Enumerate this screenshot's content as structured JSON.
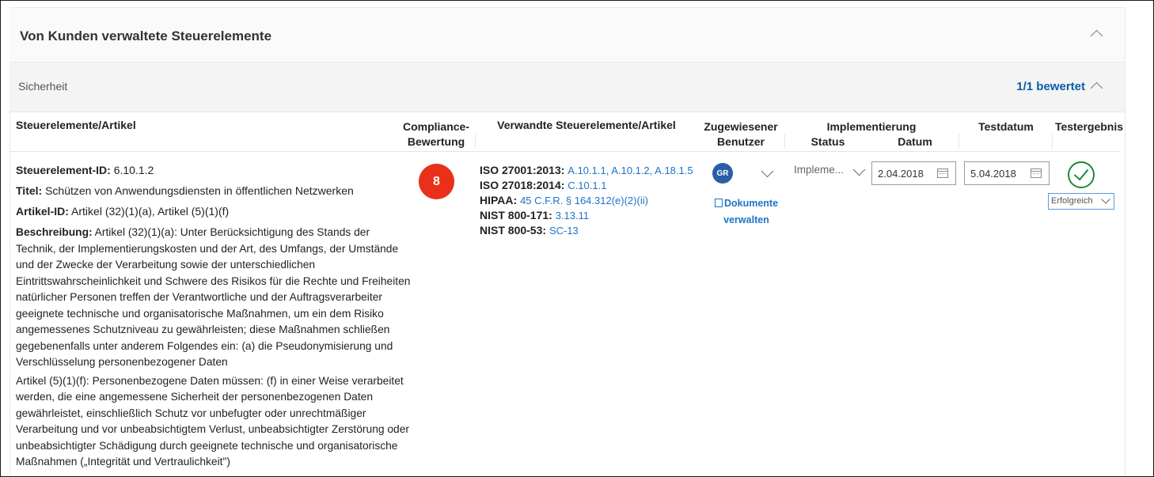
{
  "header": {
    "title": "Von Kunden verwaltete Steuerelemente"
  },
  "section": {
    "label": "Sicherheit",
    "rated": "1/1 bewertet"
  },
  "columns": {
    "controls": "Steuerelemente/Artikel",
    "score_l1": "Compliance-",
    "score_l2": "Bewertung",
    "related": "Verwandte Steuerelemente/Artikel",
    "user_l1": "Zugewiesener",
    "user_l2": "Benutzer",
    "impl": "Implementierung",
    "impl_status": "Status",
    "impl_date": "Datum",
    "test_date": "Testdatum",
    "test_result": "Testergebnis"
  },
  "row": {
    "control_id_label": "Steuerelement-ID:",
    "control_id": "6.10.1.2",
    "title_label": "Titel:",
    "title": "Schützen von Anwendungsdiensten in öffentlichen Netzwerken",
    "article_label": "Artikel-ID:",
    "article": "Artikel (32)(1)(a), Artikel (5)(1)(f)",
    "desc_label": "Beschreibung:",
    "desc_1": "Artikel (32)(1)(a): Unter Berücksichtigung des Stands der Technik, der Implementierungskosten und der Art, des Umfangs, der Umstände und der Zwecke der Verarbeitung sowie der unterschiedlichen Eintrittswahrscheinlichkeit und Schwere des Risikos für die Rechte und Freiheiten natürlicher Personen treffen der Verantwortliche und der Auftragsverarbeiter geeignete technische und organisatorische Maßnahmen, um ein dem Risiko angemessenes Schutzniveau zu gewährleisten; diese Maßnahmen schließen gegebenenfalls unter anderem Folgendes ein: (a) die Pseudonymisierung und Verschlüsselung personenbezogener Daten",
    "desc_2": "Artikel (5)(1)(f): Personenbezogene Daten müssen: (f) in einer Weise verarbeitet werden, die eine angemessene Sicherheit der personenbezogenen Daten gewährleistet, einschließlich Schutz vor unbefugter oder unrechtmäßiger Verarbeitung und vor unbeabsichtigtem Verlust, unbeabsichtigter Zerstörung oder unbeabsichtigter Schädigung durch geeignete technische und organisatorische Maßnahmen („Integrität und Vertraulichkeit\")",
    "score": "8",
    "related": {
      "iso27001_label": "ISO 27001:2013:",
      "iso27001_links": "A.10.1.1, A.10.1.2, A.18.1.5",
      "iso27018_label": "ISO 27018:2014:",
      "iso27018_links": "C.10.1.1",
      "hipaa_label": "HIPAA:",
      "hipaa_links": "45 C.F.R. § 164.312(e)(2)(ii)",
      "nist171_label": "NIST 800-171:",
      "nist171_links": "3.13.11",
      "nist53_label": "NIST 800-53:",
      "nist53_links": "SC-13"
    },
    "user_initials": "GR",
    "docs_l1": "Dokumente",
    "docs_l2": "verwalten",
    "impl_status": "Impleme...",
    "impl_date": "2.04.2018",
    "test_date": "5.04.2018",
    "test_result": "Erfolgreich"
  },
  "colors": {
    "accent": "#0b5cab",
    "link": "#1e73c6",
    "score_bg": "#e8301a",
    "success": "#1a8a3c"
  },
  "icons": [
    "chevron-up-icon",
    "chevron-down-icon",
    "calendar-icon",
    "check-circle-icon",
    "document-icon"
  ]
}
